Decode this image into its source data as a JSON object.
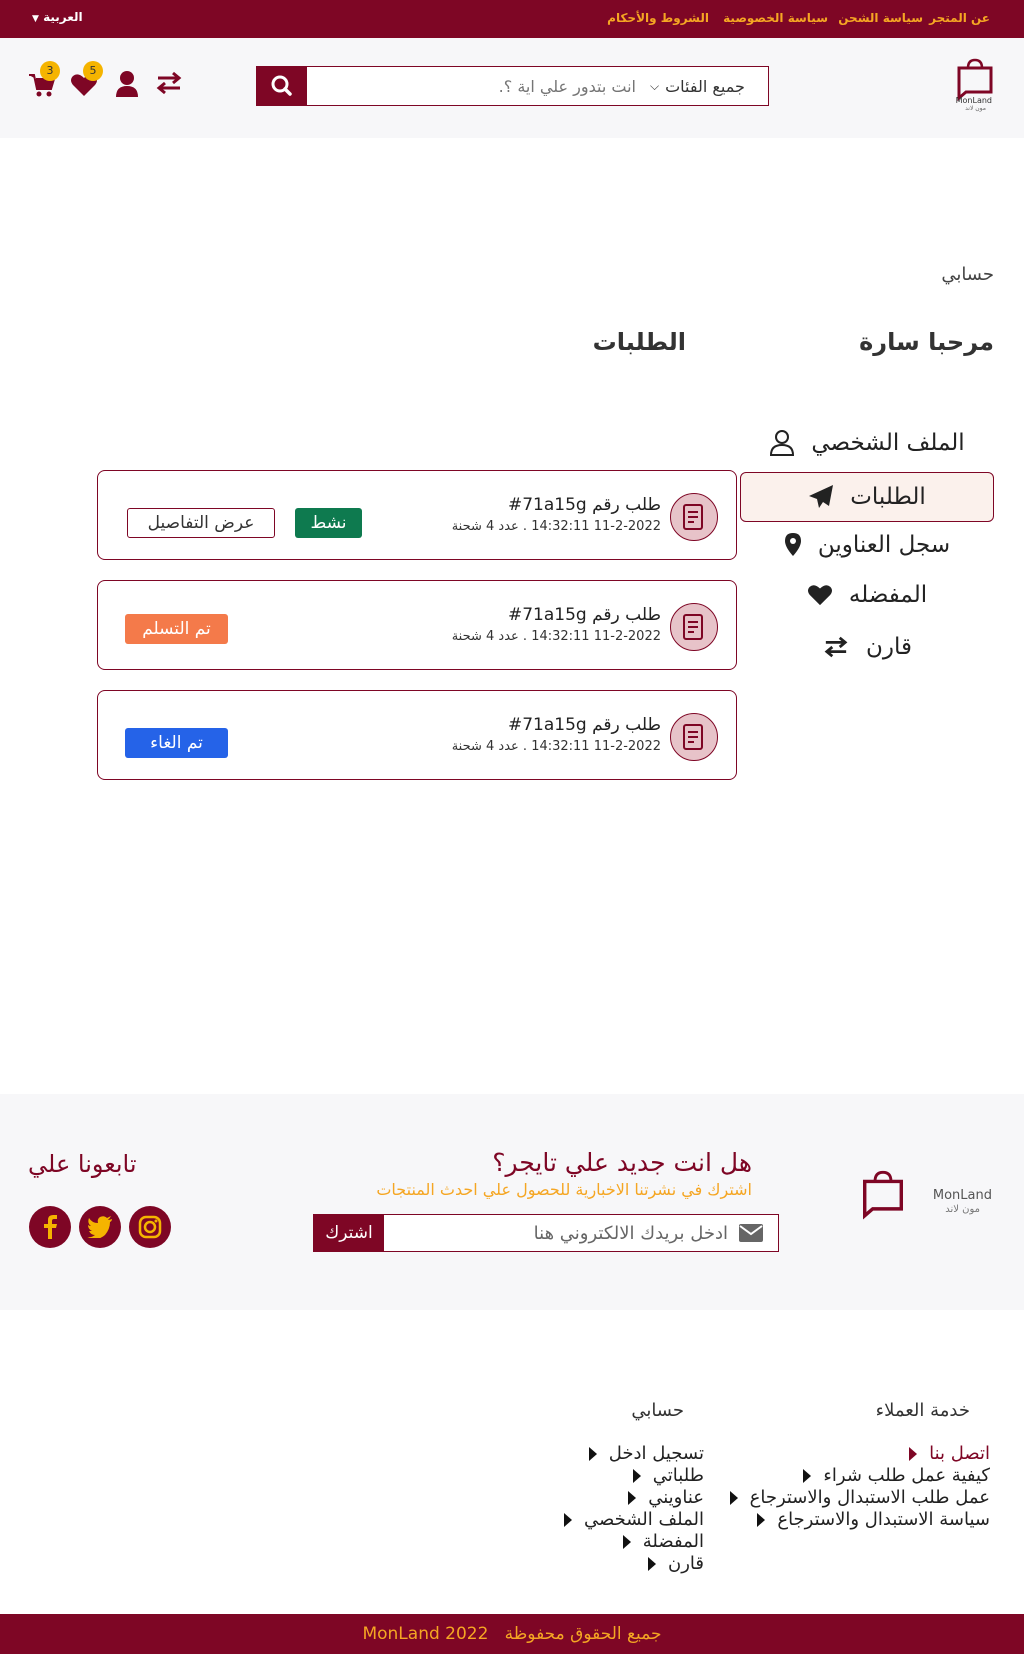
{
  "topbar": {
    "links": [
      "عن المتجر",
      "سياسة الشحن",
      "سياسة الخصوصية",
      "الشروط والأحكام"
    ],
    "language": "العربية"
  },
  "header": {
    "logo_text": "MonLand",
    "logo_subtext": "مون لاند",
    "category_select": "جميع الفئات",
    "search_placeholder": "انت بتدور علي اية ؟.",
    "cart_count": "3",
    "wishlist_count": "5"
  },
  "breadcrumb": "حسابي",
  "welcome": {
    "greeting": "مرحبا",
    "name": "سارة"
  },
  "orders_title": "الطلبات",
  "account_menu": [
    {
      "label": "الملف الشخصي",
      "icon": "user-outline-icon",
      "active": false
    },
    {
      "label": "الطلبات",
      "icon": "paper-plane-icon",
      "active": true
    },
    {
      "label": "سجل العناوين",
      "icon": "map-marker-icon",
      "active": false
    },
    {
      "label": "المفضله",
      "icon": "heart-icon",
      "active": false
    },
    {
      "label": "قارن",
      "icon": "exchange-icon",
      "active": false
    }
  ],
  "orders": [
    {
      "number": "طلب رقم 71a15g#",
      "meta": "11-2-2022 14:32:11 . عدد 4 شحنة",
      "status": "نشط",
      "status_color": "#0e7a4f",
      "details_label": "عرض التفاصيل"
    },
    {
      "number": "طلب رقم 71a15g#",
      "meta": "11-2-2022 14:32:11 . عدد 4 شحنة",
      "status": "تم التسلم",
      "status_color": "#f47a4a"
    },
    {
      "number": "طلب رقم 71a15g#",
      "meta": "11-2-2022 14:32:11 . عدد 4 شحنة",
      "status": "تم الغاء",
      "status_color": "#2563e8"
    }
  ],
  "newsletter": {
    "title": "هل انت جديد علي تايجر؟",
    "subtitle": "اشترك في نشرتنا الاخبارية للحصول علي احدث المنتجات",
    "placeholder": "ادخل بريدك الالكتروني هنا",
    "button": "اشترك"
  },
  "follow_us": "تابعونا علي",
  "footer": {
    "customer_service": {
      "title": "خدمة العملاء",
      "links": [
        "اتصل بنا",
        "كيفية عمل طلب شراء",
        "عمل طلب الاستبدال والاسترجاع",
        "سياسة الاستبدال والاسترجاع"
      ]
    },
    "my_account": {
      "title": "حسابي",
      "links": [
        "تسجيل  ادخل",
        "طلباتي",
        "عناويني",
        "الملف الشخصي",
        "المفضلة",
        "قارن"
      ]
    }
  },
  "copyright": "جميع الحقوق محفوظة   MonLand 2022",
  "colors": {
    "brand": "#7e0625",
    "accent": "#f5a623",
    "badge": "#f5b400"
  }
}
